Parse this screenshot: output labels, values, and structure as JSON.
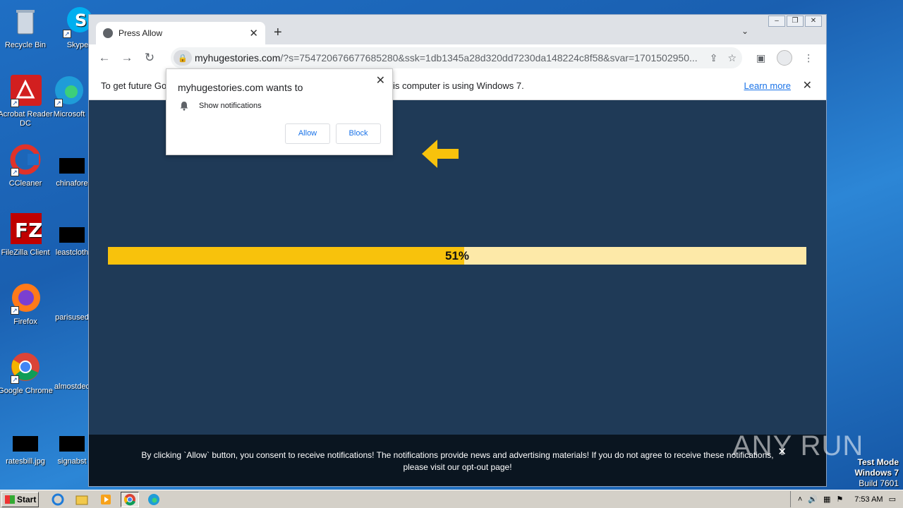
{
  "desktop": {
    "icons": [
      {
        "label": "Recycle Bin"
      },
      {
        "label": "Skype"
      },
      {
        "label": "Acrobat Reader DC"
      },
      {
        "label": "Microsoft"
      },
      {
        "label": "CCleaner"
      },
      {
        "label": "chinafore"
      },
      {
        "label": "FileZilla Client"
      },
      {
        "label": "leastcloth"
      },
      {
        "label": "Firefox"
      },
      {
        "label": "parisused"
      },
      {
        "label": "Google Chrome"
      },
      {
        "label": "almostdec"
      },
      {
        "label": "ratesbill.jpg"
      },
      {
        "label": "signabst"
      }
    ]
  },
  "browser": {
    "tab_title": "Press Allow",
    "url_host": "myhugestories.com",
    "url_path": "/?s=754720676677685280&ssk=1db1345a28d320dd7230da148224c8f58&svar=1701502950...",
    "infobar_text_left": "To get future Go",
    "infobar_text_right": "is computer is using Windows 7.",
    "infobar_link": "Learn more"
  },
  "prompt": {
    "title": "myhugestories.com wants to",
    "permission": "Show notifications",
    "allow_label": "Allow",
    "block_label": "Block"
  },
  "page": {
    "progress_percent": 51,
    "progress_label": "51%",
    "footer_line1": "By clicking `Allow` button, you consent to receive notifications! The notifications provide news and advertising materials! If you do not agree to receive these notifications,",
    "footer_line2_prefix": "please visit our ",
    "footer_link": "opt-out page",
    "footer_line2_suffix": "!"
  },
  "watermark": "ANY RUN",
  "system": {
    "test_mode": "Test Mode",
    "os_name": "Windows 7",
    "build": "Build 7601",
    "start_label": "Start",
    "clock": "7:53 AM"
  },
  "colors": {
    "page_bg": "#1f3a57",
    "progress_fill": "#f8c20c",
    "progress_track": "#fde9a8",
    "arrow": "#f8c20c",
    "link": "#1a73e8"
  }
}
